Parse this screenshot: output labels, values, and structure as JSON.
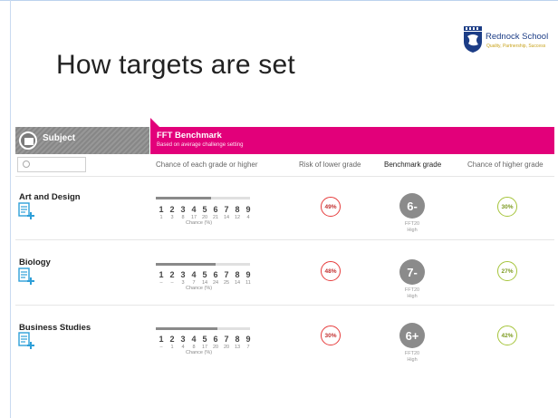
{
  "slide": {
    "title": "How targets are set"
  },
  "logo": {
    "name": "Rednock School",
    "motto": "Quality, Partnership, Success"
  },
  "table": {
    "subject_header": "Subject",
    "fft_title": "FFT Benchmark",
    "fft_subtitle": "Based on average challenge setting",
    "search_placeholder": "",
    "columns": {
      "chance_each": "Chance of each grade or higher",
      "risk_lower": "Risk of lower grade",
      "benchmark": "Benchmark grade",
      "chance_higher": "Chance of higher grade"
    },
    "grade_labels": [
      "1",
      "2",
      "3",
      "4",
      "5",
      "6",
      "7",
      "8",
      "9"
    ],
    "chance_label": "Chance (%)",
    "rows": [
      {
        "subject": "Art and Design",
        "percents": [
          "1",
          "3",
          "8",
          "17",
          "20",
          "21",
          "14",
          "12",
          "4"
        ],
        "bar_fill_fraction": 0.59,
        "risk_lower": "49%",
        "benchmark": "6-",
        "benchmark_sub1": "FFT20",
        "benchmark_sub2": "High",
        "chance_higher": "30%"
      },
      {
        "subject": "Biology",
        "percents": [
          "–",
          "–",
          "3",
          "7",
          "14",
          "24",
          "25",
          "14",
          "11"
        ],
        "bar_fill_fraction": 0.63,
        "risk_lower": "48%",
        "benchmark": "7-",
        "benchmark_sub1": "FFT20",
        "benchmark_sub2": "High",
        "chance_higher": "27%"
      },
      {
        "subject": "Business Studies",
        "percents": [
          "–",
          "1",
          "4",
          "8",
          "17",
          "20",
          "20",
          "13",
          "7"
        ],
        "bar_fill_fraction": 0.65,
        "risk_lower": "30%",
        "benchmark": "6+",
        "benchmark_sub1": "FFT20",
        "benchmark_sub2": "High",
        "chance_higher": "42%"
      }
    ]
  },
  "colors": {
    "accent": "#e2007a",
    "header_gray": "#8e8e8e",
    "ring_red": "#e63b3b",
    "ring_green": "#a5c43a",
    "benchmark_gray": "#8b8b8b"
  }
}
